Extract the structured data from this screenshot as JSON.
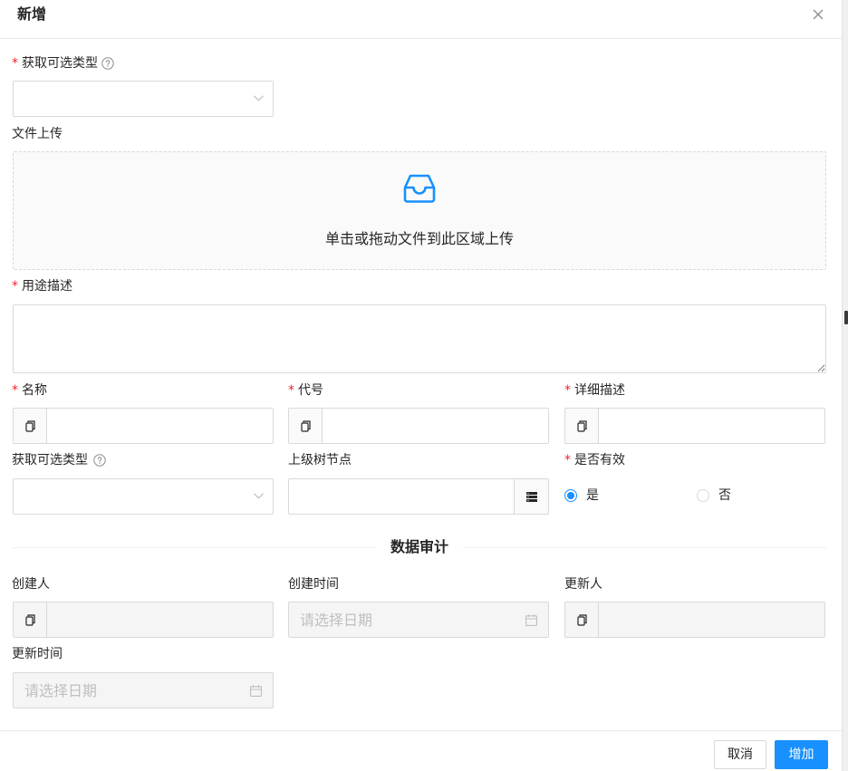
{
  "modal": {
    "title": "新增",
    "close_icon": "close-icon"
  },
  "form": {
    "required_mark": "*",
    "option_type": {
      "label": "获取可选类型",
      "required": true,
      "help_icon": "question-circle-icon",
      "selected_value": "",
      "dropdown_icon": "chevron-down-icon"
    },
    "file_upload": {
      "label": "文件上传",
      "icon": "inbox-icon",
      "hint": "单击或拖动文件到此区域上传"
    },
    "usage_description": {
      "label": "用途描述",
      "required": true,
      "value": ""
    },
    "name": {
      "label": "名称",
      "required": true,
      "prefix_icon": "copy-icon",
      "value": ""
    },
    "code": {
      "label": "代号",
      "required": true,
      "prefix_icon": "copy-icon",
      "value": ""
    },
    "detail_description": {
      "label": "详细描述",
      "required": true,
      "prefix_icon": "copy-icon",
      "value": ""
    },
    "option_type_secondary": {
      "label": "获取可选类型",
      "required": false,
      "help_icon": "question-circle-icon",
      "selected_value": "",
      "dropdown_icon": "chevron-down-icon"
    },
    "parent_tree_node": {
      "label": "上级树节点",
      "required": false,
      "value": "",
      "suffix_icon": "database-icon"
    },
    "is_valid": {
      "label": "是否有效",
      "required": true,
      "options": [
        {
          "label": "是",
          "checked": true
        },
        {
          "label": "否",
          "checked": false
        }
      ]
    }
  },
  "audit": {
    "divider_label": "数据审计",
    "creator": {
      "label": "创建人",
      "disabled": true,
      "value": "",
      "prefix_icon": "copy-icon"
    },
    "created_time": {
      "label": "创建时间",
      "disabled": true,
      "placeholder": "请选择日期",
      "icon": "calendar-icon"
    },
    "updater": {
      "label": "更新人",
      "disabled": true,
      "value": "",
      "prefix_icon": "copy-icon"
    },
    "updated_time": {
      "label": "更新时间",
      "disabled": true,
      "placeholder": "请选择日期",
      "icon": "calendar-icon"
    }
  },
  "footer": {
    "cancel_label": "取消",
    "submit_label": "增加"
  },
  "colors": {
    "primary": "#1890ff",
    "required": "#f5222d",
    "border": "#d9d9d9",
    "disabled_bg": "#f5f5f5",
    "placeholder": "#bfbfbf",
    "text": "#262626"
  }
}
